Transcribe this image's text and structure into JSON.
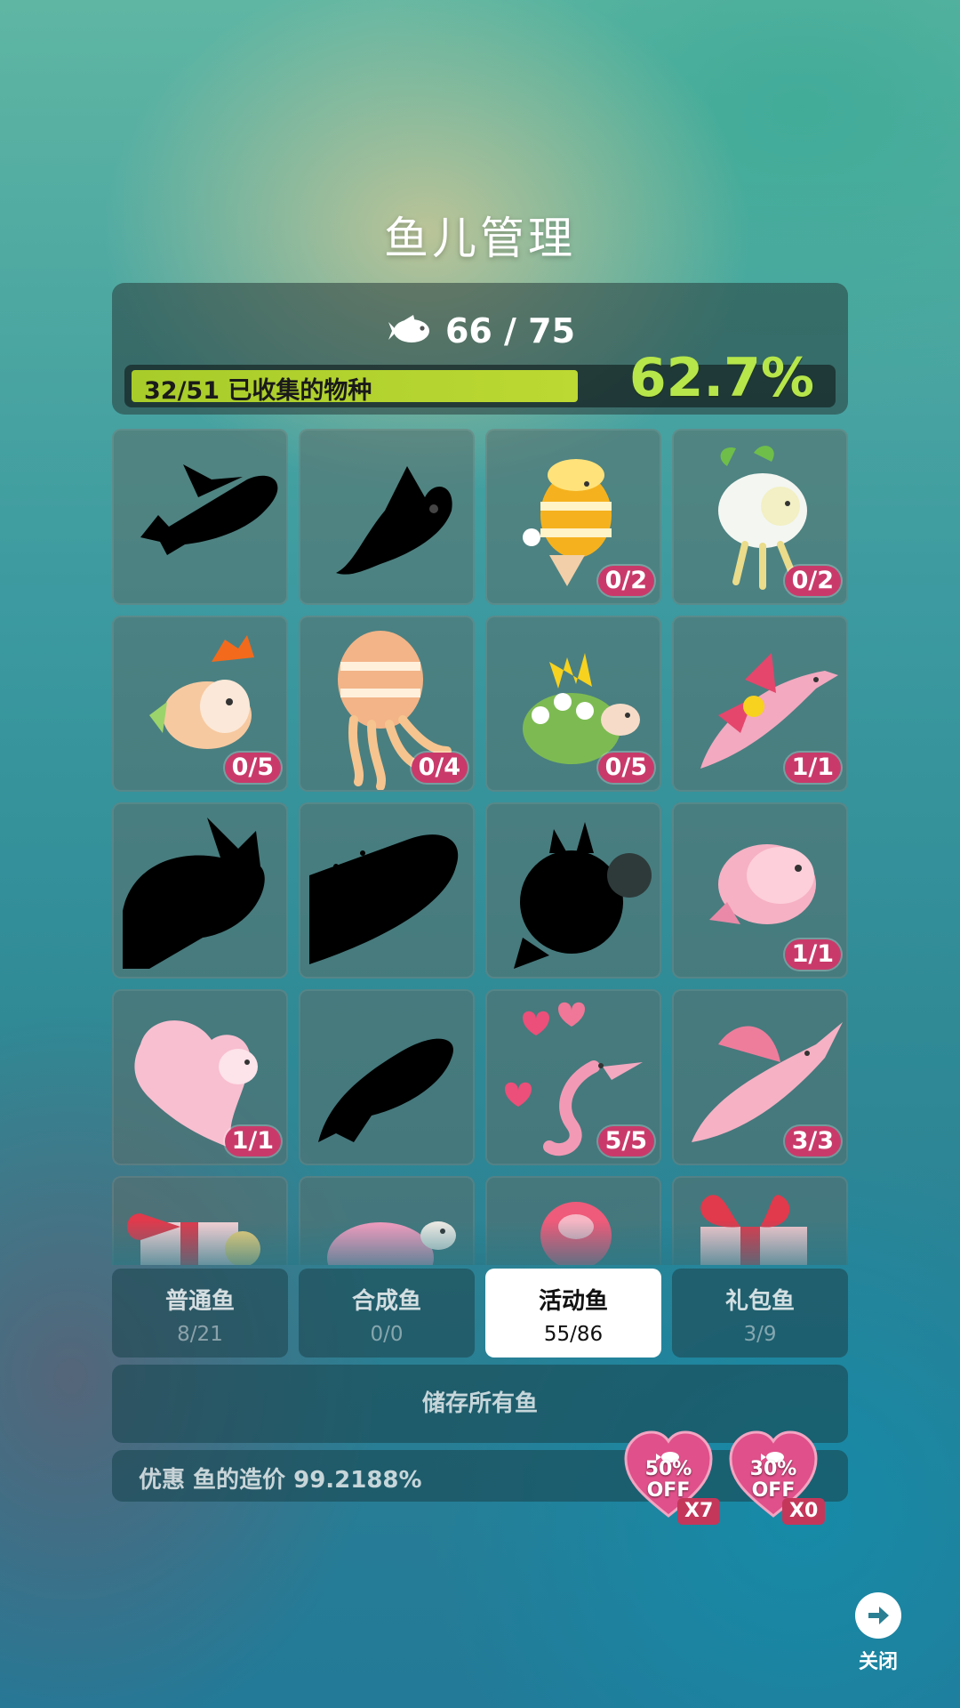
{
  "title": "鱼儿管理",
  "stats": {
    "fish_count": "66 / 75",
    "collected_label": "32/51 已收集的物种",
    "collected_fraction": 0.627,
    "percent": "62.7%"
  },
  "fish": [
    {
      "name": "silhouette-bunny-fish",
      "badge": ""
    },
    {
      "name": "silhouette-bird-fish",
      "badge": ""
    },
    {
      "name": "easter-egg-fish",
      "badge": "0/2"
    },
    {
      "name": "sprout-jellyfish",
      "badge": "0/2"
    },
    {
      "name": "flower-hat-fish",
      "badge": "0/5"
    },
    {
      "name": "egg-squid",
      "badge": "0/4"
    },
    {
      "name": "flower-turtle",
      "badge": "0/5"
    },
    {
      "name": "flower-dolphin",
      "badge": "1/1"
    },
    {
      "name": "silhouette-bunny-large",
      "badge": ""
    },
    {
      "name": "silhouette-whale",
      "badge": ""
    },
    {
      "name": "silhouette-bunny-ball",
      "badge": ""
    },
    {
      "name": "pink-blob-fish",
      "badge": "1/1"
    },
    {
      "name": "pink-betta-fish",
      "badge": "1/1"
    },
    {
      "name": "silhouette-fish",
      "badge": ""
    },
    {
      "name": "heart-seahorse",
      "badge": "5/5"
    },
    {
      "name": "pink-swordfish",
      "badge": "3/3"
    },
    {
      "name": "gift-fish-partial",
      "badge": ""
    },
    {
      "name": "pink-turtle-partial",
      "badge": ""
    },
    {
      "name": "pink-jellyfish-partial",
      "badge": ""
    },
    {
      "name": "gift-box-partial",
      "badge": ""
    }
  ],
  "tabs": [
    {
      "label": "普通鱼",
      "count": "8/21"
    },
    {
      "label": "合成鱼",
      "count": "0/0"
    },
    {
      "label": "活动鱼",
      "count": "55/86"
    },
    {
      "label": "礼包鱼",
      "count": "3/9"
    }
  ],
  "store_all": "储存所有鱼",
  "discount_text": "优惠 鱼的造价 99.2188%",
  "coupons": [
    {
      "off": "50%",
      "off_word": "OFF",
      "qty": "X7"
    },
    {
      "off": "30%",
      "off_word": "OFF",
      "qty": "X0"
    }
  ],
  "close_label": "关闭",
  "colors": {
    "accent_green": "#b6e64a",
    "badge_pink": "#c93a6a",
    "progress_green": "#a8cc2a"
  }
}
